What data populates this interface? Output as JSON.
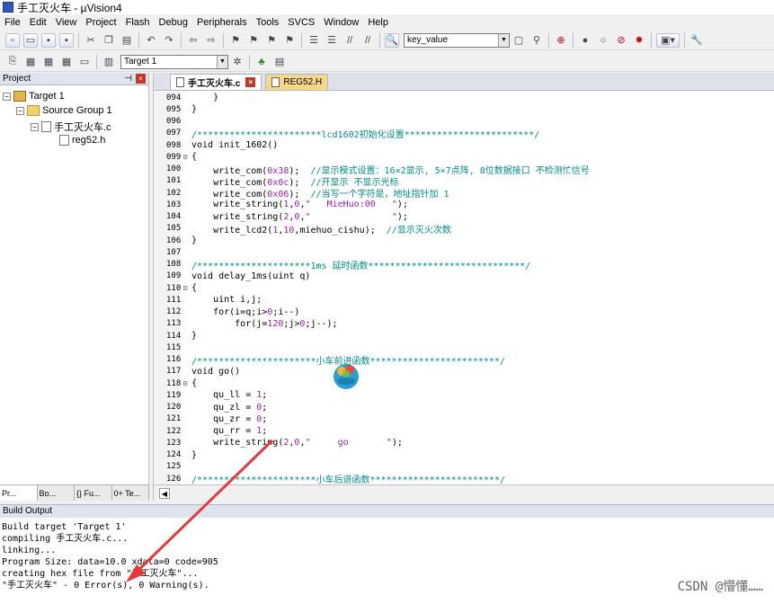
{
  "window": {
    "title": "手工灭火车 - µVision4"
  },
  "menu": [
    "File",
    "Edit",
    "View",
    "Project",
    "Flash",
    "Debug",
    "Peripherals",
    "Tools",
    "SVCS",
    "Window",
    "Help"
  ],
  "toolbar": {
    "find_value": "key_value",
    "target": "Target 1"
  },
  "project": {
    "header": "Project",
    "tree": [
      {
        "label": "Target 1",
        "level": 0
      },
      {
        "label": "Source Group 1",
        "level": 1
      },
      {
        "label": "手工灭火车.c",
        "level": 2
      },
      {
        "label": "reg52.h",
        "level": 3
      }
    ],
    "tabs": [
      "Pr...",
      "Bo...",
      "{} Fu...",
      "0+ Te..."
    ]
  },
  "editor": {
    "tabs": [
      {
        "label": "手工灭火车.c",
        "active": true
      },
      {
        "label": "REG52.H",
        "active": false
      }
    ],
    "lines": [
      {
        "n": "094",
        "t": "    }"
      },
      {
        "n": "095",
        "t": "}"
      },
      {
        "n": "096",
        "t": ""
      },
      {
        "n": "097",
        "t": "/***********************lcd1602初始化设置************************/"
      },
      {
        "n": "098",
        "t": "void init_1602()"
      },
      {
        "n": "099",
        "t": "{"
      },
      {
        "n": "100",
        "t": "    write_com(0x38);  //显示模式设置：16×2显示, 5×7点阵, 8位数据接口 不检测忙信号"
      },
      {
        "n": "101",
        "t": "    write_com(0x0c);  //开显示 不显示光标"
      },
      {
        "n": "102",
        "t": "    write_com(0x06);  //当写一个字符是，地址指针加 1"
      },
      {
        "n": "103",
        "t": "    write_string(1,0,\"   MieHuo:00   \");"
      },
      {
        "n": "104",
        "t": "    write_string(2,0,\"               \");"
      },
      {
        "n": "105",
        "t": "    write_lcd2(1,10,miehuo_cishu);  //显示灭火次数"
      },
      {
        "n": "106",
        "t": "}"
      },
      {
        "n": "107",
        "t": ""
      },
      {
        "n": "108",
        "t": "/*********************1ms 延时函数*****************************/"
      },
      {
        "n": "109",
        "t": "void delay_1ms(uint q)"
      },
      {
        "n": "110",
        "t": "{"
      },
      {
        "n": "111",
        "t": "    uint i,j;"
      },
      {
        "n": "112",
        "t": "    for(i=q;i>0;i--)"
      },
      {
        "n": "113",
        "t": "        for(j=120;j>0;j--);"
      },
      {
        "n": "114",
        "t": "}"
      },
      {
        "n": "115",
        "t": ""
      },
      {
        "n": "116",
        "t": "/**********************小车前进函数************************/"
      },
      {
        "n": "117",
        "t": "void go()"
      },
      {
        "n": "118",
        "t": "{"
      },
      {
        "n": "119",
        "t": "    qu_ll = 1;"
      },
      {
        "n": "120",
        "t": "    qu_zl = 0;"
      },
      {
        "n": "121",
        "t": "    qu_zr = 0;"
      },
      {
        "n": "122",
        "t": "    qu_rr = 1;"
      },
      {
        "n": "123",
        "t": "    write_string(2,0,\"     go       \");"
      },
      {
        "n": "124",
        "t": "}"
      },
      {
        "n": "125",
        "t": ""
      },
      {
        "n": "126",
        "t": "/**********************小车后退函数************************/"
      }
    ]
  },
  "build": {
    "header": "Build Output",
    "lines": [
      "Build target 'Target 1'",
      "compiling 手工灭火车.c...",
      "linking...",
      "Program Size: data=10.0 xdata=0 code=905",
      "creating hex file from \"手工灭火车\"...",
      "\"手工灭火车\" - 0 Error(s), 0 Warning(s)."
    ]
  },
  "watermark": "CSDN @懵懂……",
  "colors": {
    "comment": "#008b8b",
    "number": "#9b1fb0",
    "arrow": "#e53935"
  }
}
